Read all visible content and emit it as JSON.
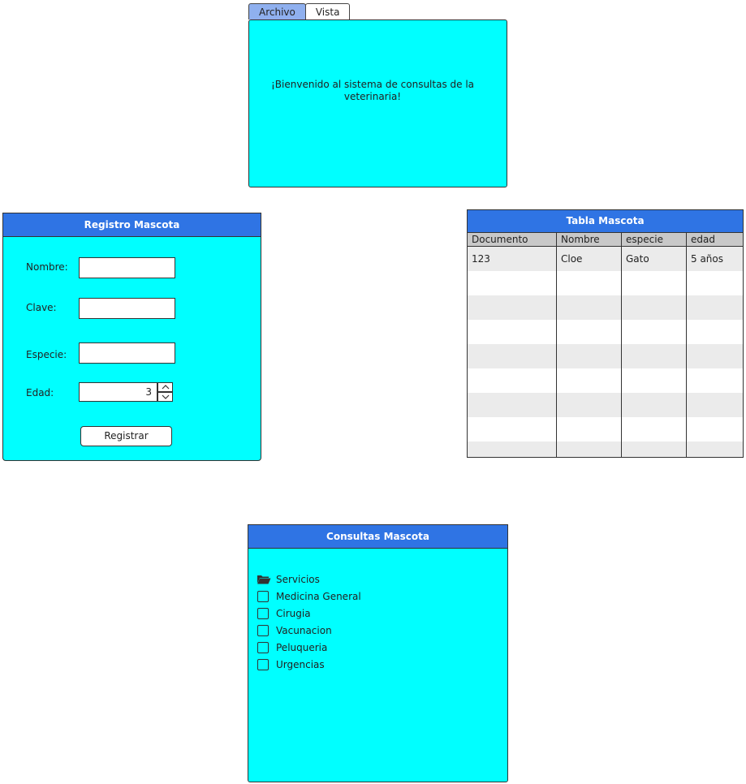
{
  "menu": {
    "tabs": [
      {
        "label": "Archivo",
        "active": true
      },
      {
        "label": "Vista",
        "active": false
      }
    ]
  },
  "welcome": {
    "message": "¡Bienvenido al sistema de consultas de la veterinaria!"
  },
  "registro": {
    "title": "Registro Mascota",
    "fields": {
      "nombre_label": "Nombre:",
      "nombre_value": "",
      "clave_label": "Clave:",
      "clave_value": "",
      "especie_label": "Especie:",
      "especie_value": "",
      "edad_label": "Edad:",
      "edad_value": "3"
    },
    "register_label": "Registrar"
  },
  "tabla": {
    "title": "Tabla Mascota",
    "columns": [
      "Documento",
      "Nombre",
      "especie",
      "edad"
    ],
    "rows": [
      [
        "123",
        "Cloe",
        "Gato",
        "5 años"
      ]
    ]
  },
  "consultas": {
    "title": "Consultas Mascota",
    "root": {
      "label": "Servicios",
      "icon": "folder-open-icon"
    },
    "items": [
      {
        "label": "Medicina General",
        "checked": false
      },
      {
        "label": "Cirugia",
        "checked": false
      },
      {
        "label": "Vacunacion",
        "checked": false
      },
      {
        "label": "Peluqueria",
        "checked": false
      },
      {
        "label": "Urgencias",
        "checked": false
      }
    ]
  },
  "colors": {
    "panel_bg": "#00ffff",
    "titlebar_bg": "#2f74e4",
    "active_tab": "#8fb0ef"
  }
}
